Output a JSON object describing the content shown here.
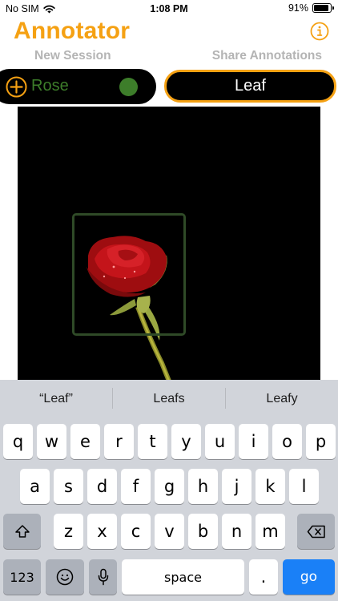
{
  "status_bar": {
    "carrier": "No SIM",
    "time": "1:08 PM",
    "battery": "91%",
    "battery_level": 0.91
  },
  "header": {
    "title": "Annotator",
    "new_session": "New Session",
    "share_annotations": "Share Annotations",
    "info_icon": "info-circle-icon"
  },
  "labels": {
    "active_label": "Rose",
    "active_color": "#3d7d2a",
    "new_label_value": "Leaf"
  },
  "accent_color": "#f5a113",
  "keyboard": {
    "suggestions": [
      "“Leaf”",
      "Leafs",
      "Leafy"
    ],
    "row1": [
      "q",
      "w",
      "e",
      "r",
      "t",
      "y",
      "u",
      "i",
      "o",
      "p"
    ],
    "row2": [
      "a",
      "s",
      "d",
      "f",
      "g",
      "h",
      "j",
      "k",
      "l"
    ],
    "row3": [
      "z",
      "x",
      "c",
      "v",
      "b",
      "n",
      "m"
    ],
    "numbers_key": "123",
    "space_key": "space",
    "period_key": ".",
    "go_key": "go"
  }
}
